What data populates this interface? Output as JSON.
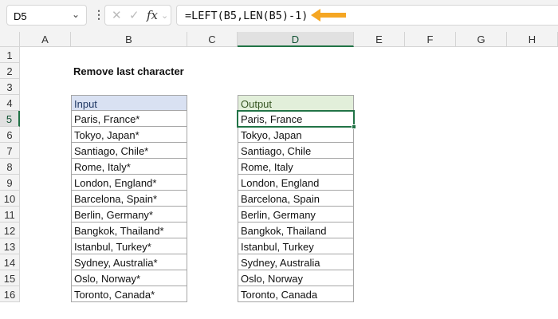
{
  "name_box": "D5",
  "formula": "=LEFT(B5,LEN(B5)-1)",
  "fx_label": "fx",
  "columns": [
    "A",
    "B",
    "C",
    "D",
    "E",
    "F",
    "G",
    "H"
  ],
  "selected_column": "D",
  "selected_row": 5,
  "row_count": 16,
  "title": "Remove last character",
  "input_header": "Input",
  "output_header": "Output",
  "inputs": [
    "Paris, France*",
    "Tokyo, Japan*",
    "Santiago, Chile*",
    "Rome, Italy*",
    "London, England*",
    "Barcelona, Spain*",
    "Berlin, Germany*",
    "Bangkok, Thailand*",
    "Istanbul, Turkey*",
    "Sydney, Australia*",
    "Oslo, Norway*",
    "Toronto, Canada*"
  ],
  "outputs": [
    "Paris, France",
    "Tokyo, Japan",
    "Santiago, Chile",
    "Rome, Italy",
    "London, England",
    "Barcelona, Spain",
    "Berlin, Germany",
    "Bangkok, Thailand",
    "Istanbul, Turkey",
    "Sydney, Australia",
    "Oslo, Norway",
    "Toronto, Canada"
  ],
  "colors": {
    "input_header_bg": "#d9e1f2",
    "output_header_bg": "#e2efda",
    "selection": "#217346",
    "arrow": "#f5a623"
  }
}
